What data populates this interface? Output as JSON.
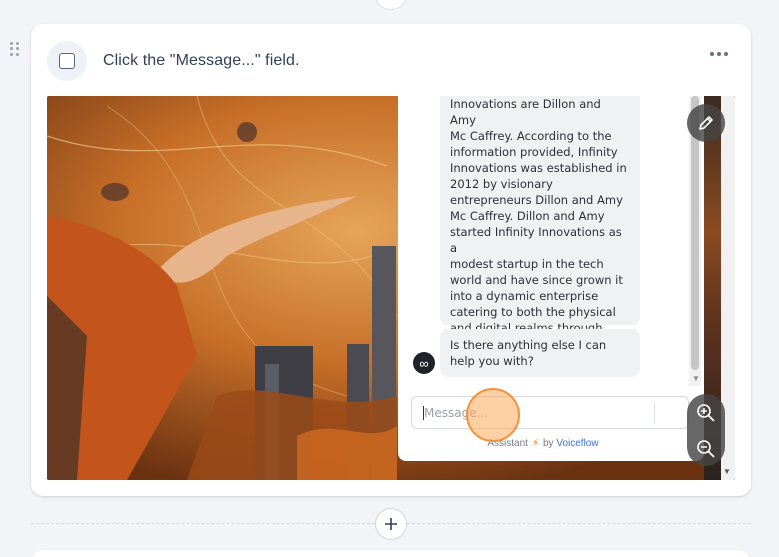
{
  "step": {
    "instruction": "Click the \"Message...\" field."
  },
  "chat": {
    "long_message": "Innovations are Dillon and Amy\nMc Caffrey. According to the\ninformation provided, Infinity\nInnovations was established in\n2012 by visionary\nentrepreneurs Dillon and Amy\nMc Caffrey. Dillon and Amy\nstarted Infinity Innovations as a\nmodest startup in the tech\nworld and have since grown it\ninto a dynamic enterprise\ncatering to both the physical\nand digital realms through\ninnovative products.",
    "short_message": "Is there anything else I can\nhelp you with?",
    "avatar_glyph": "∞",
    "input_placeholder": "Message...",
    "footer_prefix": "Assistant",
    "footer_bolt": "⚡",
    "footer_by": "by",
    "footer_brand": "Voiceflow"
  },
  "icons": {
    "step_menu": "more-horizontal-icon",
    "edit": "pencil-icon",
    "zoom_in": "zoom-in-icon",
    "zoom_out": "zoom-out-icon",
    "add": "plus-icon",
    "drag": "drag-handle-icon"
  },
  "colors": {
    "page_bg": "#f2f4f7",
    "brand_link": "#3d6fd8",
    "bolt": "#ff6a13",
    "click_highlight": "#f38c32"
  }
}
